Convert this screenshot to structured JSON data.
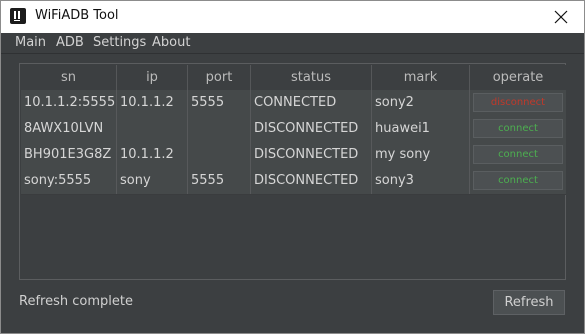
{
  "window": {
    "title": "WiFiADB Tool"
  },
  "menu": {
    "items": [
      "Main",
      "ADB",
      "Settings",
      "About"
    ]
  },
  "table": {
    "columns": [
      "sn",
      "ip",
      "port",
      "status",
      "mark",
      "operate"
    ],
    "rows": [
      {
        "sn": "10.1.1.2:5555",
        "ip": "10.1.1.2",
        "port": "5555",
        "status": "CONNECTED",
        "mark": "sony2",
        "operate": "disconnect",
        "operate_color": "#c0392b"
      },
      {
        "sn": "8AWX10LVN",
        "ip": "",
        "port": "",
        "status": "DISCONNECTED",
        "mark": "huawei1",
        "operate": "connect",
        "operate_color": "#4caf50"
      },
      {
        "sn": "BH901E3G8Z",
        "ip": "10.1.1.2",
        "port": "",
        "status": "DISCONNECTED",
        "mark": "my sony",
        "operate": "connect",
        "operate_color": "#4caf50"
      },
      {
        "sn": "sony:5555",
        "ip": "sony",
        "port": "5555",
        "status": "DISCONNECTED",
        "mark": "sony3",
        "operate": "connect",
        "operate_color": "#4caf50"
      }
    ]
  },
  "footer": {
    "status": "Refresh complete",
    "refresh_label": "Refresh"
  },
  "colors": {
    "background": "#3c3f41",
    "row_background": "#45494a",
    "text": "#d6d6d6",
    "connect": "#4caf50",
    "disconnect": "#c0392b"
  },
  "icons": {
    "app": "app-icon",
    "close": "close-icon"
  }
}
